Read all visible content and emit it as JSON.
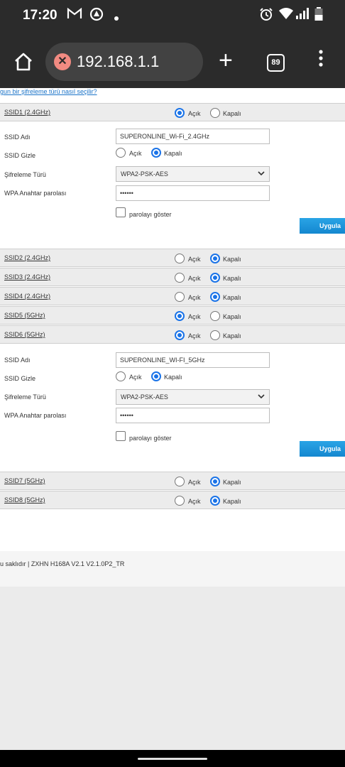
{
  "status": {
    "time": "17:20",
    "icons": [
      "gmail-icon",
      "vpn-icon",
      "dot-icon",
      "alarm-icon",
      "wifi-icon",
      "signal-icon",
      "battery-icon"
    ]
  },
  "browser": {
    "url": "192.168.1.1",
    "tab_count": "89"
  },
  "page": {
    "top_link": "gun bir şifreleme türü nasıl seçilir?",
    "radio_on_label": "Açık",
    "radio_off_label": "Kapalı",
    "ssid_rows": [
      {
        "name": "SSID1 (2.4GHz)",
        "enabled": true
      },
      {
        "name": "SSID2 (2.4GHz)",
        "enabled": false
      },
      {
        "name": "SSID3 (2.4GHz)",
        "enabled": false
      },
      {
        "name": "SSID4 (2.4GHz)",
        "enabled": false
      },
      {
        "name": "SSID5 (5GHz)",
        "enabled": true
      },
      {
        "name": "SSID6 (5GHz)",
        "enabled": true
      },
      {
        "name": "SSID7 (5GHz)",
        "enabled": false
      },
      {
        "name": "SSID8 (5GHz)",
        "enabled": false
      }
    ],
    "panels": [
      {
        "ssid_name_label": "SSID Adı",
        "ssid_name_value": "SUPERONLINE_Wi-Fi_2.4GHz",
        "ssid_hidden_label": "SSID Gizle",
        "ssid_hidden": false,
        "encryption_label": "Şifreleme Türü",
        "encryption_value": "WPA2-PSK-AES",
        "password_label": "WPA Anahtar parolası",
        "password_value": "••••••",
        "show_password_label": "parolayı göster",
        "apply_label": "Uygula"
      },
      {
        "ssid_name_label": "SSID Adı",
        "ssid_name_value": "SUPERONLINE_WI-FI_5GHz",
        "ssid_hidden_label": "SSID Gizle",
        "ssid_hidden": false,
        "encryption_label": "Şifreleme Türü",
        "encryption_value": "WPA2-PSK-AES",
        "password_label": "WPA Anahtar parolası",
        "password_value": "••••••",
        "show_password_label": "parolayı göster",
        "apply_label": "Uygula"
      }
    ],
    "footer": "u saklıdır  |   ZXHN H168A V2.1 V2.1.0P2_TR"
  }
}
